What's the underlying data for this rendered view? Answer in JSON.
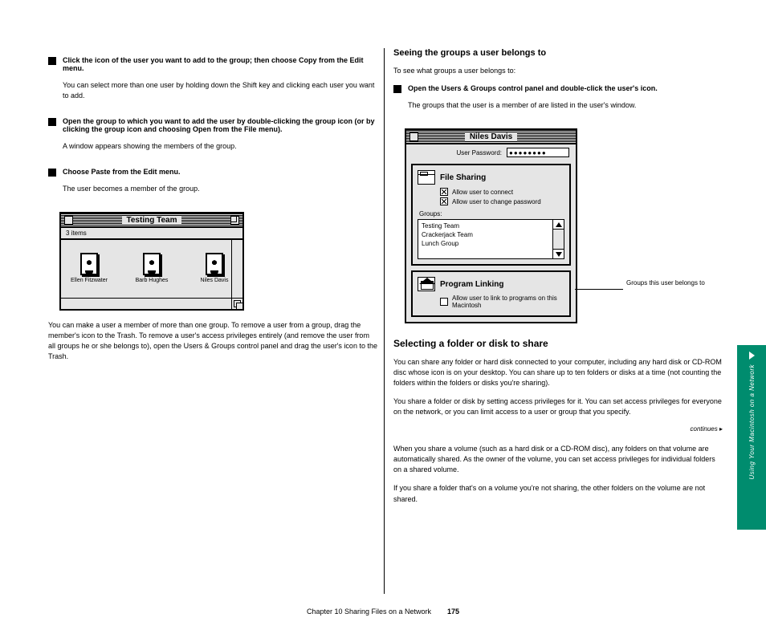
{
  "left": {
    "steps": {
      "s3": {
        "title": "Click the icon of the user you want to add to the group; then choose Copy from the Edit menu.",
        "body": "You can select more than one user by holding down the Shift key and clicking each user you want to add."
      },
      "s4": {
        "title": "Open the group to which you want to add the user by double-clicking the group icon (or by clicking the group icon and choosing Open from the File menu).",
        "body": "A window appears showing the members of the group."
      },
      "s5": {
        "title": "Choose Paste from the Edit menu.",
        "body": "The user becomes a member of the group."
      }
    },
    "group_window": {
      "title": "Testing Team",
      "info": "3 items",
      "members": [
        "Ellen Fitzwater",
        "Barb Hughes",
        "Niles Davis"
      ]
    },
    "after_group": "You can make a user a member of more than one group. To remove a user from a group, drag the member's icon to the Trash. To remove a user's access privileges entirely (and remove the user from all groups he or she belongs to), open the Users & Groups control panel and drag the user's icon to the Trash."
  },
  "right": {
    "seeing_title": "Seeing the groups a user belongs to",
    "seeing_body": "To see what groups a user belongs to:",
    "step_open": {
      "title": "Open the Users & Groups control panel and double-click the user's icon.",
      "body": "The groups that the user is a member of are listed in the user's window."
    },
    "user_window": {
      "title": "Niles Davis",
      "pw_label": "User Password:",
      "pw_value": "●●●●●●●●",
      "file_sharing": {
        "title": "File Sharing",
        "allow_connect": "Allow user to connect",
        "allow_change_pw": "Allow user to change password",
        "groups_label": "Groups:",
        "groups": [
          "Testing Team",
          "Crackerjack Team",
          "Lunch Group"
        ]
      },
      "program_linking": {
        "title": "Program Linking",
        "allow_link": "Allow user to link to programs on this Macintosh"
      }
    },
    "callout": "Groups this user belongs to",
    "selecting_title": "Selecting a folder or disk to share",
    "selecting_p1": "You can share any folder or hard disk connected to your computer, including any hard disk or CD-ROM disc whose icon is on your desktop. You can share up to ten folders or disks at a time (not counting the folders within the folders or disks you're sharing).",
    "selecting_p2": "You share a folder or disk by setting access privileges for it. You can set access privileges for everyone on the network, or you can limit access to a user or group that you specify.",
    "continues": "continues",
    "tip_p1": "When you share a volume (such as a hard disk or a CD-ROM disc), any folders on that volume are automatically shared. As the owner of the volume, you can set access privileges for individual folders on a shared volume.",
    "tip_p2": "If you share a folder that's on a volume you're not sharing, the other folders on the volume are not shared."
  },
  "side_tab": "Using Your Macintosh on a Network",
  "footer": {
    "title": "Chapter 10  Sharing Files on a Network",
    "page": "175"
  }
}
